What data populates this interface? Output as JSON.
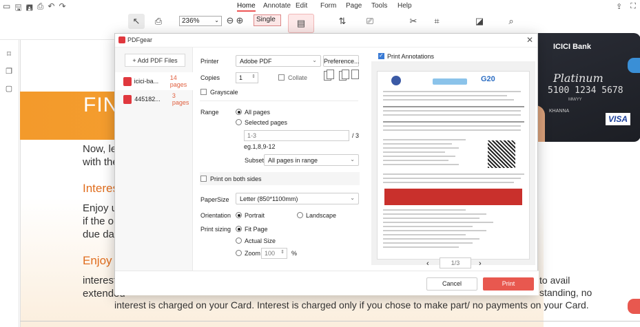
{
  "quick_access": {
    "icons": [
      "open-icon",
      "save-icon",
      "saveas-icon",
      "print-icon",
      "undo-icon",
      "redo-icon"
    ],
    "glyphs": [
      "▭",
      "🖫",
      "🖪",
      "⎙",
      "↶",
      "↷"
    ]
  },
  "menu": {
    "items": [
      "Home",
      "Annotate",
      "Edit",
      "Form",
      "Page",
      "Tools",
      "Help"
    ]
  },
  "toolbar": {
    "zoom": "236%",
    "view_mode": "Single",
    "glyphs": {
      "select": "↖",
      "print": "⎙",
      "zoom_out": "⊖",
      "zoom_in": "⊕"
    }
  },
  "document": {
    "heading": "FIN",
    "line1": "Now, let",
    "line2": "with the",
    "sub1": "Interes",
    "para1a": "Enjoy up",
    "para1b": "if the ou",
    "para1c": "due date",
    "sub2": "Enjoy t",
    "para2a": "interest",
    "para2b": "extended",
    "para2c": "interest is charged on your Card. Interest is charged only if you chose to make part/ no payments on your Card.",
    "right1": "to avail",
    "right2": "standing, no"
  },
  "card": {
    "bank": "ICICI Bank",
    "tier": "Platinum",
    "number": "5100 1234 5678",
    "network": "VISA",
    "since": "MM/YY",
    "holder": "KHANNA"
  },
  "dialog": {
    "title": "PDFgear",
    "add_pdf": "+ Add PDF Files",
    "files": [
      {
        "name": "icici-ba...",
        "pages": "14 pages"
      },
      {
        "name": "445182...",
        "pages": "3 pages"
      }
    ],
    "printer_label": "Printer",
    "printer_value": "Adobe PDF",
    "preferences": "Preference...",
    "copies_label": "Copies",
    "copies_value": "1",
    "collate": "Collate",
    "grayscale": "Grayscale",
    "range_label": "Range",
    "all_pages": "All pages",
    "selected_pages": "Selected pages",
    "range_placeholder": "1-3",
    "range_total": "/ 3",
    "range_example": "eg.1,8,9-12",
    "subset_label": "Subset",
    "subset_value": "All pages in range",
    "both_sides": "Print on both sides",
    "papersize_label": "PaperSize",
    "papersize_value": "Letter (850*1100mm)",
    "orientation_label": "Orientation",
    "portrait": "Portrait",
    "landscape": "Landscape",
    "sizing_label": "Print sizing",
    "fit_page": "Fit Page",
    "actual_size": "Actual Size",
    "zoom_label": "Zoom",
    "zoom_value": "100",
    "zoom_unit": "%",
    "print_annotations": "Print Annotations",
    "page_indicator": "1/3",
    "cancel": "Cancel",
    "print": "Print"
  },
  "colors": {
    "accent": "#e8584f",
    "orange": "#f39a2b",
    "heading_orange": "#e06d1d"
  }
}
